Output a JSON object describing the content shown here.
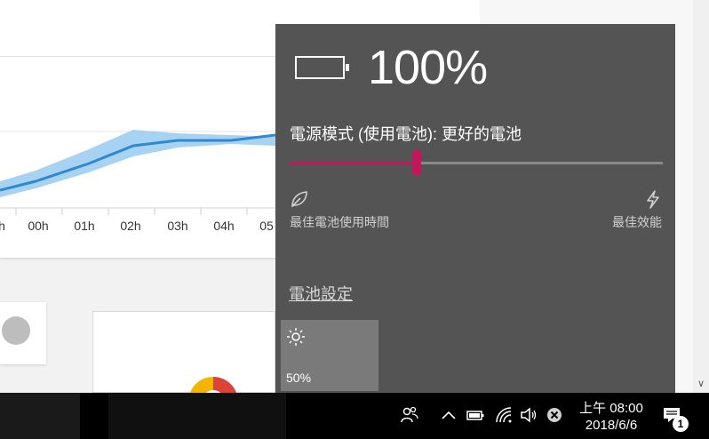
{
  "chart": {
    "tick_labels": [
      "h",
      "00h",
      "01h",
      "02h",
      "03h",
      "04h",
      "05"
    ]
  },
  "flyout": {
    "battery_percent": "100%",
    "battery_level_fraction": 1.0,
    "power_mode_label": "電源模式 (使用電池): 更好的電池",
    "slider_fraction": 0.34,
    "accent_color": "#c2185b",
    "left_icon": "leaf-icon",
    "right_icon": "bolt-icon",
    "best_battery_label": "最佳電池使用時間",
    "best_performance_label": "最佳效能",
    "battery_settings_link": "電池設定",
    "brightness_icon": "sun-icon",
    "brightness_value": "50%"
  },
  "taskbar": {
    "icons": [
      "people-icon",
      "chevron-up-icon",
      "battery-icon",
      "wifi-icon",
      "volume-icon",
      "mute-x-icon"
    ],
    "clock_time": "上午 08:00",
    "clock_date": "2018/6/6",
    "notification_count": "1"
  }
}
